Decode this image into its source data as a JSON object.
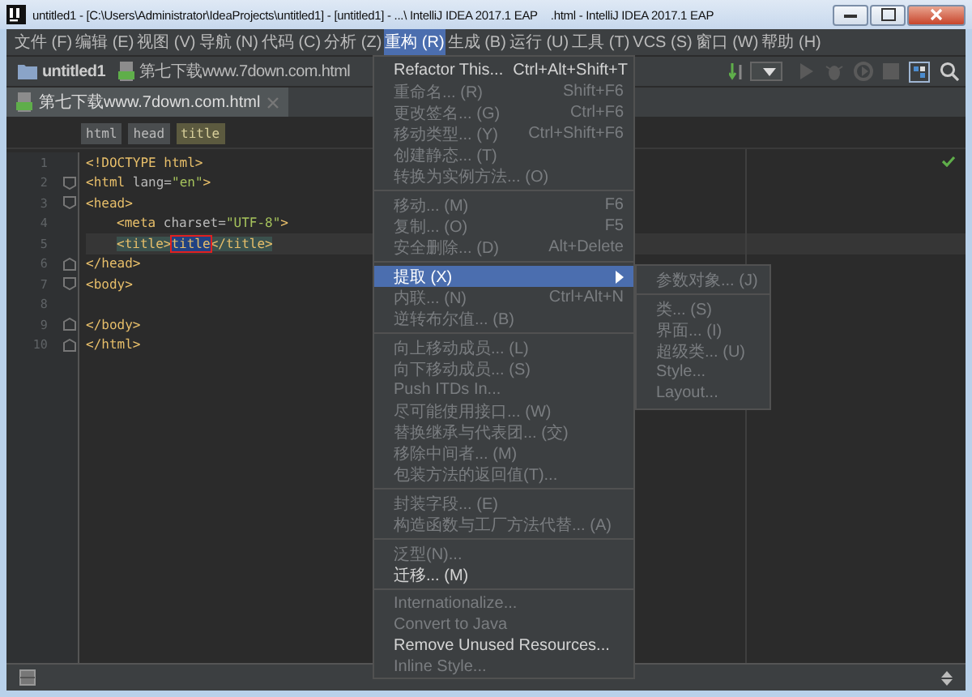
{
  "window": {
    "title": "untitled1 - [C:\\Users\\Administrator\\IdeaProjects\\untitled1] - [untitled1] - ...\\ IntelliJ IDEA 2017.1 EAP",
    "title_tail": ".html - IntelliJ IDEA 2017.1 EAP"
  },
  "menu_bar": [
    {
      "label": "文件 (F)",
      "selected": false
    },
    {
      "label": "编辑 (E)",
      "selected": false
    },
    {
      "label": "视图 (V)",
      "selected": false
    },
    {
      "label": "导航 (N)",
      "selected": false
    },
    {
      "label": "代码 (C)",
      "selected": false
    },
    {
      "label": "分析 (Z)",
      "selected": false
    },
    {
      "label": "重构 (R)",
      "selected": true
    },
    {
      "label": "生成 (B)",
      "selected": false
    },
    {
      "label": "运行 (U)",
      "selected": false
    },
    {
      "label": "工具 (T)",
      "selected": false
    },
    {
      "label": "VCS (S)",
      "selected": false
    },
    {
      "label": "窗口 (W)",
      "selected": false
    },
    {
      "label": "帮助 (H)",
      "selected": false
    }
  ],
  "nav_bar": {
    "project": "untitled1",
    "file": "第七下载www.7down.com.html"
  },
  "tabs": [
    {
      "label": "第七下载www.7down.com.html",
      "selected": true
    }
  ],
  "breadcrumbs": [
    {
      "label": "html",
      "selected": false
    },
    {
      "label": "head",
      "selected": false
    },
    {
      "label": "title",
      "selected": true
    }
  ],
  "editor": {
    "lines": [
      {
        "number": "1",
        "tokens": [
          {
            "kind": "tag",
            "text": "<!DOCTYPE html>"
          }
        ]
      },
      {
        "number": "2",
        "fold_open": true,
        "tokens": [
          {
            "kind": "tag",
            "text": "<html "
          },
          {
            "kind": "attr",
            "text": "lang="
          },
          {
            "kind": "string",
            "text": "\"en\""
          },
          {
            "kind": "tag",
            "text": ">"
          }
        ]
      },
      {
        "number": "3",
        "fold_open": true,
        "tokens": [
          {
            "kind": "tag",
            "text": "<head>"
          }
        ]
      },
      {
        "number": "4",
        "indented": true,
        "tokens": [
          {
            "kind": "tag",
            "text": "<meta "
          },
          {
            "kind": "attr",
            "text": "charset="
          },
          {
            "kind": "string",
            "text": "\"UTF-8\""
          },
          {
            "kind": "tag",
            "text": ">"
          }
        ]
      },
      {
        "number": "5",
        "indented": true,
        "highlighted": true,
        "tokens": [
          {
            "kind": "match",
            "text": "<title>"
          },
          {
            "kind": "selection",
            "text": "title"
          },
          {
            "kind": "match",
            "text": "</title>"
          }
        ]
      },
      {
        "number": "6",
        "fold_close": true,
        "tokens": [
          {
            "kind": "tag",
            "text": "</head>"
          }
        ]
      },
      {
        "number": "7",
        "fold_open": true,
        "tokens": [
          {
            "kind": "tag",
            "text": "<body>"
          }
        ]
      },
      {
        "number": "8"
      },
      {
        "number": "9",
        "fold_close": true,
        "tokens": [
          {
            "kind": "tag",
            "text": "</body>"
          }
        ]
      },
      {
        "number": "10",
        "fold_close": true,
        "tokens": [
          {
            "kind": "tag",
            "text": "</html>"
          }
        ]
      }
    ]
  },
  "menu": {
    "items": [
      {
        "kind": "item",
        "label": "Refactor This...",
        "shortcut": "Ctrl+Alt+Shift+T",
        "disabled": false,
        "selected": false
      },
      {
        "kind": "item",
        "label": "重命名... (R)",
        "shortcut": "Shift+F6",
        "disabled": true,
        "selected": false
      },
      {
        "kind": "item",
        "label": "更改签名... (G)",
        "shortcut": "Ctrl+F6",
        "disabled": true,
        "selected": false
      },
      {
        "kind": "item",
        "label": "移动类型... (Y)",
        "shortcut": "Ctrl+Shift+F6",
        "disabled": true,
        "selected": false
      },
      {
        "kind": "item",
        "label": "创建静态... (T)",
        "disabled": true,
        "selected": false
      },
      {
        "kind": "item",
        "label": "转换为实例方法... (O)",
        "disabled": true,
        "selected": false
      },
      {
        "kind": "separator"
      },
      {
        "kind": "item",
        "label": "移动... (M)",
        "shortcut": "F6",
        "disabled": true,
        "selected": false
      },
      {
        "kind": "item",
        "label": "复制... (O)",
        "shortcut": "F5",
        "disabled": true,
        "selected": false
      },
      {
        "kind": "item",
        "label": "安全删除... (D)",
        "shortcut": "Alt+Delete",
        "disabled": true,
        "selected": false
      },
      {
        "kind": "separator"
      },
      {
        "kind": "item",
        "label": "提取 (X)",
        "disabled": false,
        "selected": true,
        "submenu": true
      },
      {
        "kind": "item",
        "label": "内联... (N)",
        "shortcut": "Ctrl+Alt+N",
        "disabled": true,
        "selected": false
      },
      {
        "kind": "item",
        "label": "逆转布尔值... (B)",
        "disabled": true,
        "selected": false
      },
      {
        "kind": "separator"
      },
      {
        "kind": "item",
        "label": "向上移动成员... (L)",
        "disabled": true,
        "selected": false
      },
      {
        "kind": "item",
        "label": "向下移动成员... (S)",
        "disabled": true,
        "selected": false
      },
      {
        "kind": "item",
        "label": "Push ITDs In...",
        "disabled": true,
        "selected": false
      },
      {
        "kind": "item",
        "label": "尽可能使用接口... (W)",
        "disabled": true,
        "selected": false
      },
      {
        "kind": "item",
        "label": "替换继承与代表团... (交)",
        "disabled": true,
        "selected": false
      },
      {
        "kind": "item",
        "label": "移除中间者... (M)",
        "disabled": true,
        "selected": false
      },
      {
        "kind": "item",
        "label": "包装方法的返回值(T)...",
        "disabled": true,
        "selected": false
      },
      {
        "kind": "separator"
      },
      {
        "kind": "item",
        "label": "封装字段... (E)",
        "disabled": true,
        "selected": false
      },
      {
        "kind": "item",
        "label": "构造函数与工厂方法代替... (A)",
        "disabled": true,
        "selected": false
      },
      {
        "kind": "separator"
      },
      {
        "kind": "item",
        "label": "泛型(N)...",
        "disabled": true,
        "selected": false
      },
      {
        "kind": "item",
        "label": "迁移... (M)",
        "disabled": false,
        "selected": false
      },
      {
        "kind": "separator"
      },
      {
        "kind": "item",
        "label": "Internationalize...",
        "disabled": true,
        "selected": false
      },
      {
        "kind": "item",
        "label": "Convert to Java",
        "disabled": true,
        "selected": false
      },
      {
        "kind": "item",
        "label": "Remove Unused Resources...",
        "disabled": false,
        "selected": false
      },
      {
        "kind": "item",
        "label": "Inline Style...",
        "disabled": true,
        "selected": false
      }
    ]
  },
  "submenu": {
    "items": [
      {
        "kind": "item",
        "label": "参数对象... (J)",
        "disabled": true
      },
      {
        "kind": "separator"
      },
      {
        "kind": "item",
        "label": "类... (S)",
        "disabled": true
      },
      {
        "kind": "item",
        "label": "界面... (I)",
        "disabled": true
      },
      {
        "kind": "item",
        "label": "超级类... (U)",
        "disabled": true
      },
      {
        "kind": "item",
        "label": "Style...",
        "disabled": true
      },
      {
        "kind": "item",
        "label": "Layout...",
        "disabled": true
      }
    ]
  }
}
